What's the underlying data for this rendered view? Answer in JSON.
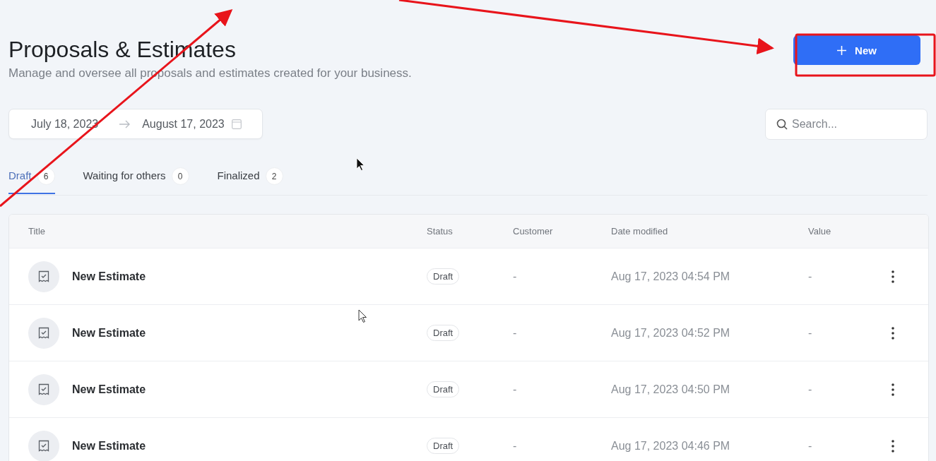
{
  "header": {
    "title": "Proposals & Estimates",
    "subtitle": "Manage and oversee all proposals and estimates created for your business.",
    "new_button": "New"
  },
  "filters": {
    "date_start": "July 18, 2023",
    "date_end": "August 17, 2023",
    "search_placeholder": "Search..."
  },
  "tabs": [
    {
      "label": "Draft",
      "count": "6",
      "selected": true
    },
    {
      "label": "Waiting for others",
      "count": "0",
      "selected": false
    },
    {
      "label": "Finalized",
      "count": "2",
      "selected": false
    }
  ],
  "table": {
    "columns": [
      "Title",
      "Status",
      "Customer",
      "Date modified",
      "Value"
    ],
    "rows": [
      {
        "title": "New Estimate",
        "status": "Draft",
        "customer": "-",
        "date_modified": "Aug 17, 2023 04:54 PM",
        "value": "-"
      },
      {
        "title": "New Estimate",
        "status": "Draft",
        "customer": "-",
        "date_modified": "Aug 17, 2023 04:52 PM",
        "value": "-"
      },
      {
        "title": "New Estimate",
        "status": "Draft",
        "customer": "-",
        "date_modified": "Aug 17, 2023 04:50 PM",
        "value": "-"
      },
      {
        "title": "New Estimate",
        "status": "Draft",
        "customer": "-",
        "date_modified": "Aug 17, 2023 04:46 PM",
        "value": "-"
      }
    ]
  }
}
